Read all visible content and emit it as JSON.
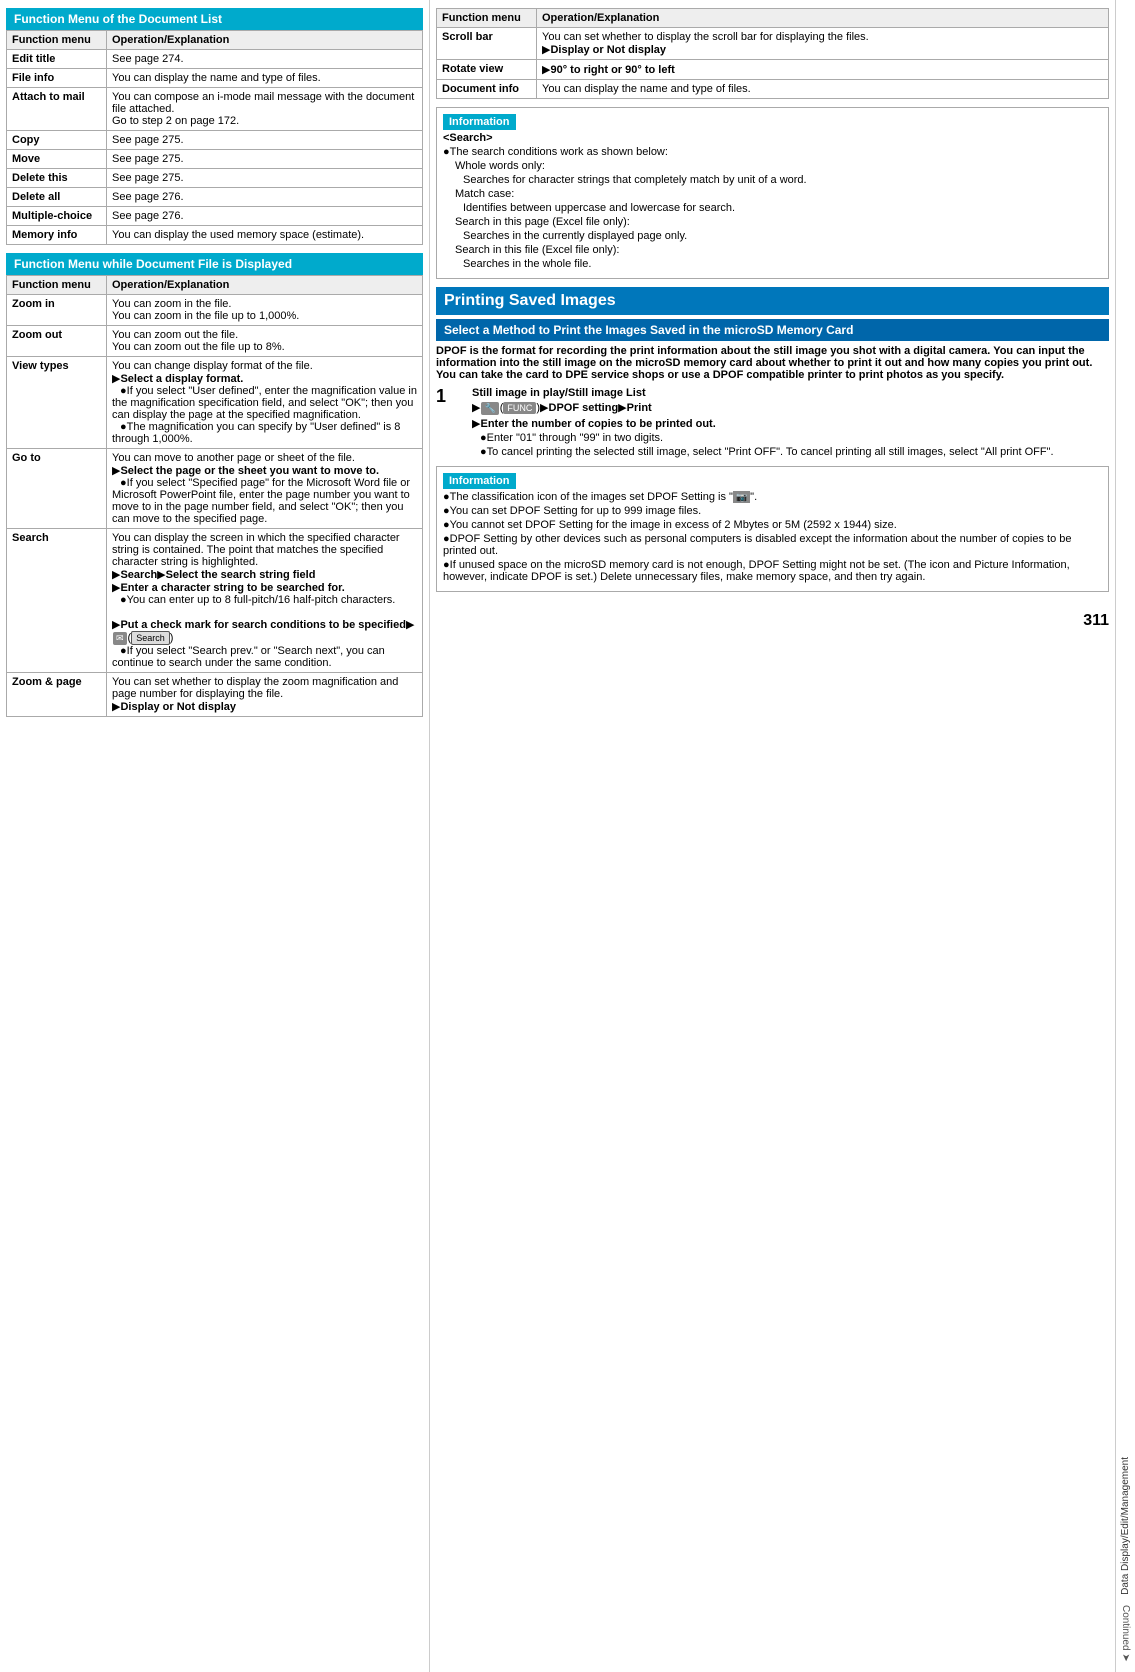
{
  "page": {
    "title": "Function Menu of the Document List",
    "page_number": "311",
    "sidebar_label": "Data Display/Edit/Management",
    "continued": "Continued"
  },
  "left_section1": {
    "header": "Function Menu of the Document List",
    "col1": "Function menu",
    "col2": "Operation/Explanation",
    "rows": [
      {
        "func": "Edit title",
        "desc": "See page 274."
      },
      {
        "func": "File info",
        "desc": "You can display the name and type of files."
      },
      {
        "func": "Attach to mail",
        "desc": "You can compose an i-mode mail message with the document file attached.\nGo to step 2 on page 172."
      },
      {
        "func": "Copy",
        "desc": "See page 275."
      },
      {
        "func": "Move",
        "desc": "See page 275."
      },
      {
        "func": "Delete this",
        "desc": "See page 275."
      },
      {
        "func": "Delete all",
        "desc": "See page 276."
      },
      {
        "func": "Multiple-choice",
        "desc": "See page 276."
      },
      {
        "func": "Memory info",
        "desc": "You can display the used memory space (estimate)."
      }
    ]
  },
  "left_section2": {
    "header": "Function Menu while Document File is Displayed",
    "col1": "Function menu",
    "col2": "Operation/Explanation",
    "rows": [
      {
        "func": "Zoom in",
        "desc": "You can zoom in the file.\nYou can zoom in the file up to 1,000%."
      },
      {
        "func": "Zoom out",
        "desc": "You can zoom out the file.\nYou can zoom out the file up to 8%."
      },
      {
        "func": "View types",
        "desc_main": "You can change display format of the file.",
        "arrow_text": "Select a display format.",
        "bullets": [
          "If you select \"User defined\", enter the magnification value in the magnification specification field, and select \"OK\"; then you can display the page at the specified magnification.",
          "The magnification you can specify by \"User defined\" is 8 through 1,000%."
        ]
      },
      {
        "func": "Go to",
        "desc_main": "You can move to another page or sheet of the file.",
        "arrow_text": "Select the page or the sheet you want to move to.",
        "bullets": [
          "If you select \"Specified page\" for the Microsoft Word file or Microsoft PowerPoint file, enter the page number you want to move to in the page number field, and select \"OK\"; then you can move to the specified page."
        ]
      },
      {
        "func": "Search",
        "desc_main": "You can display the screen in which the specified character string is contained. The point that matches the specified character string is highlighted.",
        "arrow_text1": "Search",
        "arrow_text2": "Select the search string field",
        "arrow_text3": "Enter a character string to be searched for.",
        "bullets1": [
          "You can enter up to 8 full-pitch/16 half-pitch characters."
        ],
        "arrow_text4": "Put a check mark for search conditions to be specified",
        "arrow_icon1": "envelope-icon",
        "arrow_icon2": "search-icon",
        "bullets2": [
          "If you select \"Search prev.\" or \"Search next\", you can continue to search under the same condition."
        ]
      },
      {
        "func": "Zoom & page",
        "desc_main": "You can set whether to display the zoom magnification and page number for displaying the file.",
        "arrow_text": "Display or Not display"
      }
    ]
  },
  "right_section1": {
    "col1": "Function menu",
    "col2": "Operation/Explanation",
    "rows": [
      {
        "func": "Scroll bar",
        "desc_main": "You can set whether to display the scroll bar for displaying the files.",
        "arrow_text": "Display or Not display"
      },
      {
        "func": "Rotate view",
        "arrow_text": "90° to right or 90° to left"
      },
      {
        "func": "Document info",
        "desc_main": "You can display the name and type of files."
      }
    ]
  },
  "info_search": {
    "header": "Information",
    "title": "<Search>",
    "intro": "The search conditions work as shown below:",
    "items": [
      {
        "label": "Whole words only:",
        "desc": "Searches for character strings that completely match by unit of a word."
      },
      {
        "label": "Match case:",
        "desc": "Identifies between uppercase and lowercase for search."
      },
      {
        "label": "Search in this page (Excel file only):",
        "desc": "Searches in the currently displayed page only."
      },
      {
        "label": "Search in this file (Excel file only):",
        "desc": "Searches in the whole file."
      }
    ]
  },
  "printing_section": {
    "header": "Printing Saved Images",
    "subheader": "Select a Method to Print the Images Saved in the microSD Memory Card",
    "intro_bold": "DPOF is the format for recording the print information about the still image you shot with a digital camera. You can input the information into the still image on the microSD memory card about whether to print it out and how many copies you print out. You can take the card to DPE service shops or use a DPOF compatible printer to print photos as you specify.",
    "step1": {
      "number": "1",
      "lines": [
        "Still image in play/Still image List",
        "▶ [FUNC] ▶ DPOF setting ▶ Print",
        "▶ Enter the number of copies to be printed out."
      ],
      "bullets": [
        "Enter \"01\" through \"99\" in two digits.",
        "To cancel printing the selected still image, select \"Print OFF\". To cancel printing all still images, select \"All print OFF\"."
      ]
    },
    "info_box": {
      "header": "Information",
      "bullets": [
        "The classification icon of the images set DPOF Setting is \" \".",
        "You can set DPOF Setting for up to 999 image files.",
        "You cannot set DPOF Setting for the image in excess of 2 Mbytes or 5M (2592 x 1944) size.",
        "DPOF Setting by other devices such as personal computers is disabled except the information about the number of copies to be printed out.",
        "If unused space on the microSD memory card is not enough, DPOF Setting might not be set. (The icon and Picture Information, however, indicate DPOF is set.) Delete unnecessary files, make memory space, and then try again."
      ]
    }
  }
}
